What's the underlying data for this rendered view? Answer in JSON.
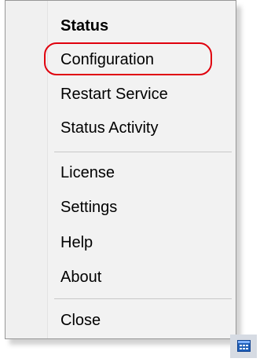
{
  "context_menu": {
    "items": [
      {
        "label": "Status",
        "bold": true
      },
      {
        "label": "Configuration",
        "highlighted": true
      },
      {
        "label": "Restart Service"
      },
      {
        "label": "Status Activity"
      },
      {
        "label": "License"
      },
      {
        "label": "Settings"
      },
      {
        "label": "Help"
      },
      {
        "label": "About"
      },
      {
        "label": "Close"
      }
    ]
  },
  "annotation": {
    "highlight_color": "#e0000d"
  },
  "tray": {
    "icon": "app-window-grid-icon"
  }
}
